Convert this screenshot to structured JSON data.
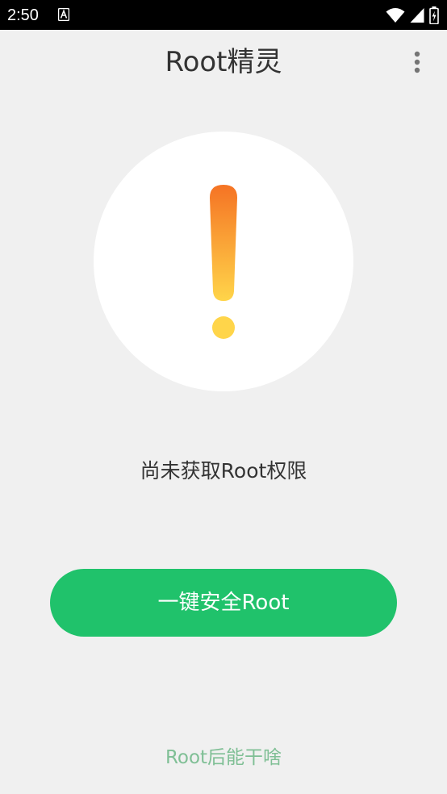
{
  "status_bar": {
    "time": "2:50",
    "notification_icon": "a-letter-icon",
    "icons": [
      "wifi-icon",
      "signal-icon",
      "battery-charging-icon"
    ]
  },
  "app_bar": {
    "title": "Root精灵",
    "menu_icon": "more-vert-icon"
  },
  "main": {
    "status_icon": "exclamation-icon",
    "status_text": "尚未获取Root权限",
    "action_button": "一键安全Root",
    "info_link": "Root后能干啥"
  },
  "colors": {
    "background": "#f0f0f0",
    "button": "#20c26b",
    "link": "#7fbf95",
    "warning_top": "#f57324",
    "warning_bottom": "#ffd54a"
  }
}
